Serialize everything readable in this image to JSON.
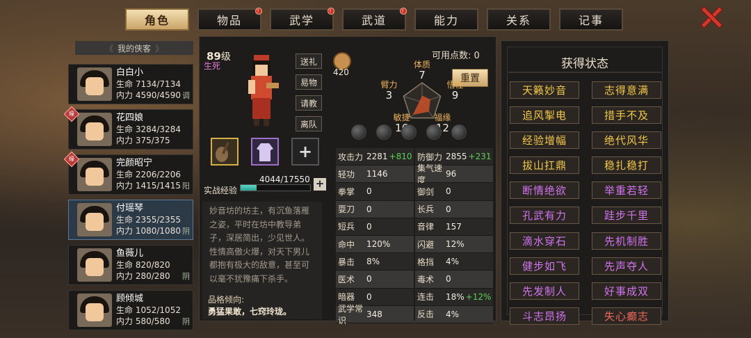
{
  "tabs": [
    {
      "label": "角色",
      "active": true,
      "dot": false
    },
    {
      "label": "物品",
      "active": false,
      "dot": true
    },
    {
      "label": "武学",
      "active": false,
      "dot": true
    },
    {
      "label": "武道",
      "active": false,
      "dot": true
    },
    {
      "label": "能力",
      "active": false,
      "dot": false
    },
    {
      "label": "关系",
      "active": false,
      "dot": false
    },
    {
      "label": "记事",
      "active": false,
      "dot": false
    }
  ],
  "tab_dot_glyph": "!",
  "roster": {
    "header": "我的侠客",
    "hp_label": "生命",
    "mp_label": "内力",
    "heroes": [
      {
        "name": "白白小",
        "hp": "7134/7134",
        "mp": "4590/4590",
        "tag": "调",
        "badge": ""
      },
      {
        "name": "花四娘",
        "hp": "3284/3284",
        "mp": "375/375",
        "tag": "",
        "badge": "缘"
      },
      {
        "name": "完颜昭宁",
        "hp": "2206/2206",
        "mp": "1415/1415",
        "tag": "阳",
        "badge": "缘"
      },
      {
        "name": "付瑶琴",
        "hp": "2355/2355",
        "mp": "1080/1080",
        "tag": "阴",
        "badge": "",
        "selected": true
      },
      {
        "name": "鱼薇儿",
        "hp": "820/820",
        "mp": "280/280",
        "tag": "阴",
        "badge": ""
      },
      {
        "name": "顾倾城",
        "hp": "1052/1052",
        "mp": "580/580",
        "tag": "阴",
        "badge": ""
      }
    ]
  },
  "character": {
    "level": "89",
    "level_unit": "级",
    "sect": "生死",
    "actions": [
      "送礼",
      "易物",
      "请教",
      "离队"
    ],
    "exp_label": "实战经验",
    "exp_text": "4044/17550",
    "exp_fraction": 0.23,
    "exp_plus": "+",
    "slot_plus": "+",
    "bio": "妙音坊的坊主，有沉鱼落雁之姿，平时在坊中教导弟子，深居简出，少见世人。性情高傲火爆，对天下男儿都抱有极大的敌意，甚至可以毫不犹豫痛下杀手。",
    "trait_label": "品格倾向:",
    "trait_text": "勇猛果敢，七窍玲珑。"
  },
  "attributes": {
    "points_label": "可用点数:",
    "points": "0",
    "reset_label": "重置",
    "coin_value": "420",
    "items": [
      {
        "label": "体质",
        "value": "7"
      },
      {
        "label": "悟性",
        "value": "9"
      },
      {
        "label": "福缘",
        "value": "12"
      },
      {
        "label": "敏捷",
        "value": "16"
      },
      {
        "label": "臂力",
        "value": "3"
      }
    ]
  },
  "stats": [
    [
      {
        "k": "攻击力",
        "v": "2281",
        "b": "+810"
      },
      {
        "k": "防御力",
        "v": "2855",
        "b": "+231"
      }
    ],
    [
      {
        "k": "轻功",
        "v": "1146",
        "b": ""
      },
      {
        "k": "集气速度",
        "v": "96",
        "b": ""
      }
    ],
    [
      {
        "k": "拳掌",
        "v": "0",
        "b": ""
      },
      {
        "k": "御剑",
        "v": "0",
        "b": ""
      }
    ],
    [
      {
        "k": "耍刀",
        "v": "0",
        "b": ""
      },
      {
        "k": "长兵",
        "v": "0",
        "b": ""
      }
    ],
    [
      {
        "k": "短兵",
        "v": "0",
        "b": ""
      },
      {
        "k": "音律",
        "v": "157",
        "b": ""
      }
    ],
    [
      {
        "k": "命中",
        "v": "120%",
        "b": ""
      },
      {
        "k": "闪避",
        "v": "12%",
        "b": ""
      }
    ],
    [
      {
        "k": "暴击",
        "v": "8%",
        "b": ""
      },
      {
        "k": "格挡",
        "v": "4%",
        "b": ""
      }
    ],
    [
      {
        "k": "医术",
        "v": "0",
        "b": ""
      },
      {
        "k": "毒术",
        "v": "0",
        "b": ""
      }
    ],
    [
      {
        "k": "暗器",
        "v": "0",
        "b": ""
      },
      {
        "k": "连击",
        "v": "18%",
        "b": "+12%"
      }
    ],
    [
      {
        "k": "武学常识",
        "v": "348",
        "b": ""
      },
      {
        "k": "反击",
        "v": "4%",
        "b": ""
      }
    ]
  ],
  "status": {
    "title": "获得状态",
    "colors": {
      "y": "#f2c848",
      "p": "#d074f0",
      "r": "#ee6a5a"
    },
    "items": [
      {
        "label": "天籁妙音",
        "c": "y"
      },
      {
        "label": "志得意满",
        "c": "y"
      },
      {
        "label": "追风掣电",
        "c": "y"
      },
      {
        "label": "措手不及",
        "c": "y"
      },
      {
        "label": "经验增幅",
        "c": "y"
      },
      {
        "label": "绝代风华",
        "c": "y"
      },
      {
        "label": "拔山扛鼎",
        "c": "y"
      },
      {
        "label": "稳扎稳打",
        "c": "y"
      },
      {
        "label": "断情绝欲",
        "c": "p"
      },
      {
        "label": "举重若轻",
        "c": "p"
      },
      {
        "label": "孔武有力",
        "c": "p"
      },
      {
        "label": "跬步千里",
        "c": "p"
      },
      {
        "label": "滴水穿石",
        "c": "p"
      },
      {
        "label": "先机制胜",
        "c": "p"
      },
      {
        "label": "健步如飞",
        "c": "p"
      },
      {
        "label": "先声夺人",
        "c": "p"
      },
      {
        "label": "先发制人",
        "c": "p"
      },
      {
        "label": "好事成双",
        "c": "p"
      },
      {
        "label": "斗志昂扬",
        "c": "p"
      },
      {
        "label": "失心癫志",
        "c": "r"
      }
    ]
  }
}
